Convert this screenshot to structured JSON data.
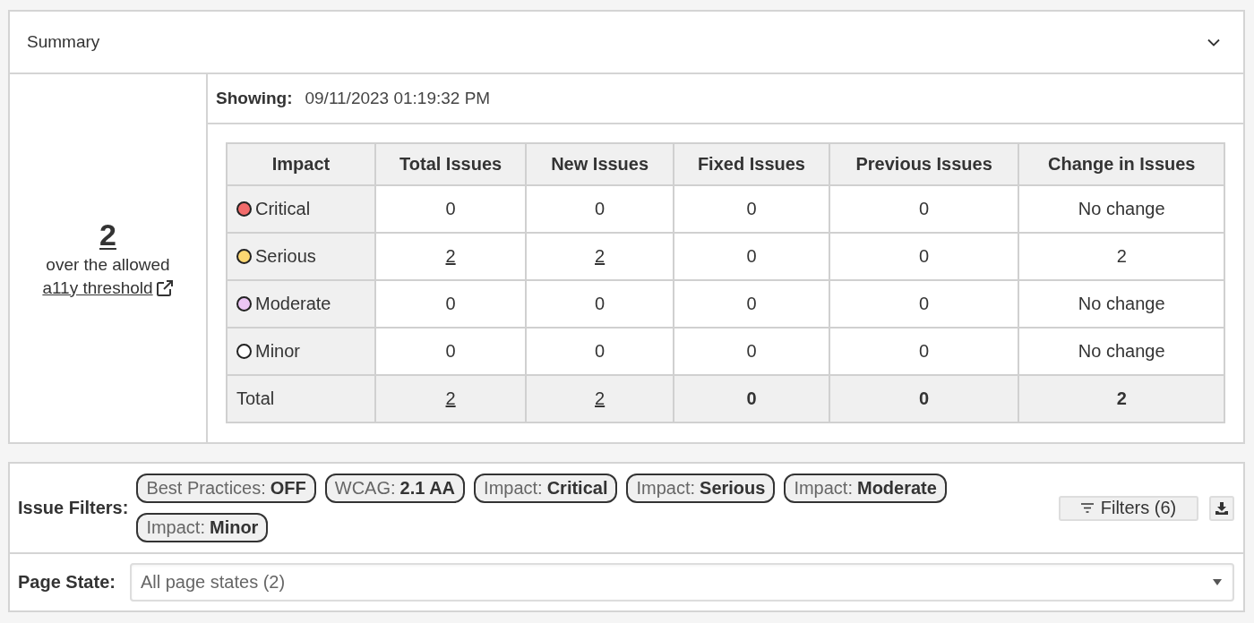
{
  "summary": {
    "title": "Summary"
  },
  "threshold": {
    "count": "2",
    "text": "over the allowed",
    "link": "a11y threshold"
  },
  "showing": {
    "label": "Showing:",
    "value": "09/11/2023 01:19:32 PM"
  },
  "table": {
    "columns": [
      "Impact",
      "Total Issues",
      "New Issues",
      "Fixed Issues",
      "Previous Issues",
      "Change in Issues"
    ],
    "rows": [
      {
        "kind": "impact",
        "cells": [
          {
            "kind": "impact",
            "text": "Critical",
            "color": "#f26b6b"
          },
          {
            "kind": "plain",
            "text": "0"
          },
          {
            "kind": "plain",
            "text": "0"
          },
          {
            "kind": "plain",
            "text": "0"
          },
          {
            "kind": "plain",
            "text": "0"
          },
          {
            "kind": "plain",
            "text": "No change"
          }
        ]
      },
      {
        "kind": "impact",
        "cells": [
          {
            "kind": "impact",
            "text": "Serious",
            "color": "#fcd772"
          },
          {
            "kind": "link",
            "text": "2"
          },
          {
            "kind": "link",
            "text": "2"
          },
          {
            "kind": "plain",
            "text": "0"
          },
          {
            "kind": "plain",
            "text": "0"
          },
          {
            "kind": "plain",
            "text": "2"
          }
        ]
      },
      {
        "kind": "impact",
        "cells": [
          {
            "kind": "impact",
            "text": "Moderate",
            "color": "#ebc5f5"
          },
          {
            "kind": "plain",
            "text": "0"
          },
          {
            "kind": "plain",
            "text": "0"
          },
          {
            "kind": "plain",
            "text": "0"
          },
          {
            "kind": "plain",
            "text": "0"
          },
          {
            "kind": "plain",
            "text": "No change"
          }
        ]
      },
      {
        "kind": "impact",
        "cells": [
          {
            "kind": "impact",
            "text": "Minor",
            "color": "#ffffff"
          },
          {
            "kind": "plain",
            "text": "0"
          },
          {
            "kind": "plain",
            "text": "0"
          },
          {
            "kind": "plain",
            "text": "0"
          },
          {
            "kind": "plain",
            "text": "0"
          },
          {
            "kind": "plain",
            "text": "No change"
          }
        ]
      },
      {
        "kind": "total",
        "cells": [
          {
            "kind": "label",
            "text": "Total"
          },
          {
            "kind": "link",
            "text": "2"
          },
          {
            "kind": "link",
            "text": "2"
          },
          {
            "kind": "plain",
            "text": "0"
          },
          {
            "kind": "plain",
            "text": "0"
          },
          {
            "kind": "plain",
            "text": "2"
          }
        ]
      }
    ]
  },
  "filters": {
    "label": "Issue Filters:",
    "chips": [
      {
        "label": "Best Practices:",
        "value": "OFF"
      },
      {
        "label": "WCAG:",
        "value": "2.1 AA"
      },
      {
        "label": "Impact:",
        "value": "Critical"
      },
      {
        "label": "Impact:",
        "value": "Serious"
      },
      {
        "label": "Impact:",
        "value": "Moderate"
      },
      {
        "label": "Impact:",
        "value": "Minor"
      }
    ],
    "button": "Filters (6)"
  },
  "page_state": {
    "label": "Page State:",
    "value": "All page states (2)"
  }
}
